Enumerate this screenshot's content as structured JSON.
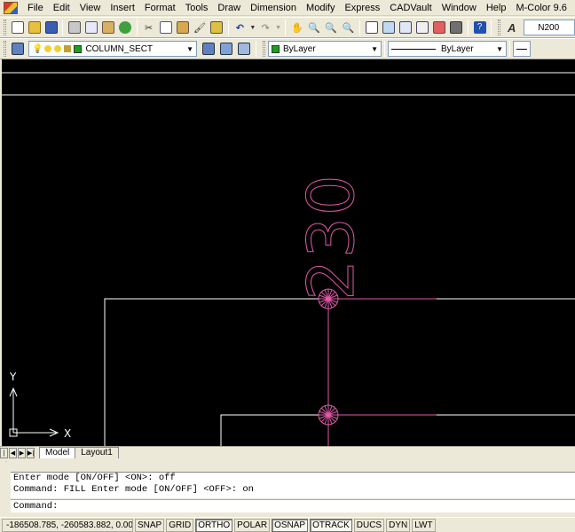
{
  "menu": {
    "items": [
      "File",
      "Edit",
      "View",
      "Insert",
      "Format",
      "Tools",
      "Draw",
      "Dimension",
      "Modify",
      "Express",
      "CADVault",
      "Window",
      "Help",
      "M-Color 9.6"
    ]
  },
  "toolbar1": {
    "text_style_value": "N200",
    "icons": [
      "new-icon",
      "open-icon",
      "save-icon",
      "print-icon",
      "plot-preview-icon",
      "publish-icon",
      "3d-dwf-icon",
      "cut-icon",
      "copy-icon",
      "paste-icon",
      "match-properties-icon",
      "block-editor-icon",
      "undo-icon",
      "redo-icon",
      "pan-icon",
      "zoom-realtime-icon",
      "zoom-window-icon",
      "zoom-previous-icon",
      "properties-icon",
      "design-center-icon",
      "tool-palettes-icon",
      "sheet-set-icon",
      "markup-icon",
      "calculator-icon",
      "help-icon",
      "text-style-icon"
    ]
  },
  "toolbar2": {
    "layer_name": "COLUMN_SECT",
    "color_value": "ByLayer",
    "linetype_value": "ByLayer",
    "layer_color": "#16a21b"
  },
  "drawing": {
    "label_text": "230",
    "label_color": "#e05aa8",
    "line_color": "#ffffff",
    "bg_color": "#000000"
  },
  "ucs": {
    "x_label": "X",
    "y_label": "Y"
  },
  "tabs": {
    "model": "Model",
    "layout1": "Layout1"
  },
  "command": {
    "history": [
      "Enter mode [ON/OFF] <ON>: off",
      "Command:  FILL Enter mode [ON/OFF] <OFF>: on"
    ],
    "prompt": "Command:"
  },
  "status": {
    "coords": "-186508.785, -260583.882, 0.000",
    "buttons": [
      {
        "label": "SNAP",
        "on": false
      },
      {
        "label": "GRID",
        "on": false
      },
      {
        "label": "ORTHO",
        "on": true
      },
      {
        "label": "POLAR",
        "on": false
      },
      {
        "label": "OSNAP",
        "on": true
      },
      {
        "label": "OTRACK",
        "on": true
      },
      {
        "label": "DUCS",
        "on": false
      },
      {
        "label": "DYN",
        "on": false
      },
      {
        "label": "LWT",
        "on": false
      }
    ]
  }
}
